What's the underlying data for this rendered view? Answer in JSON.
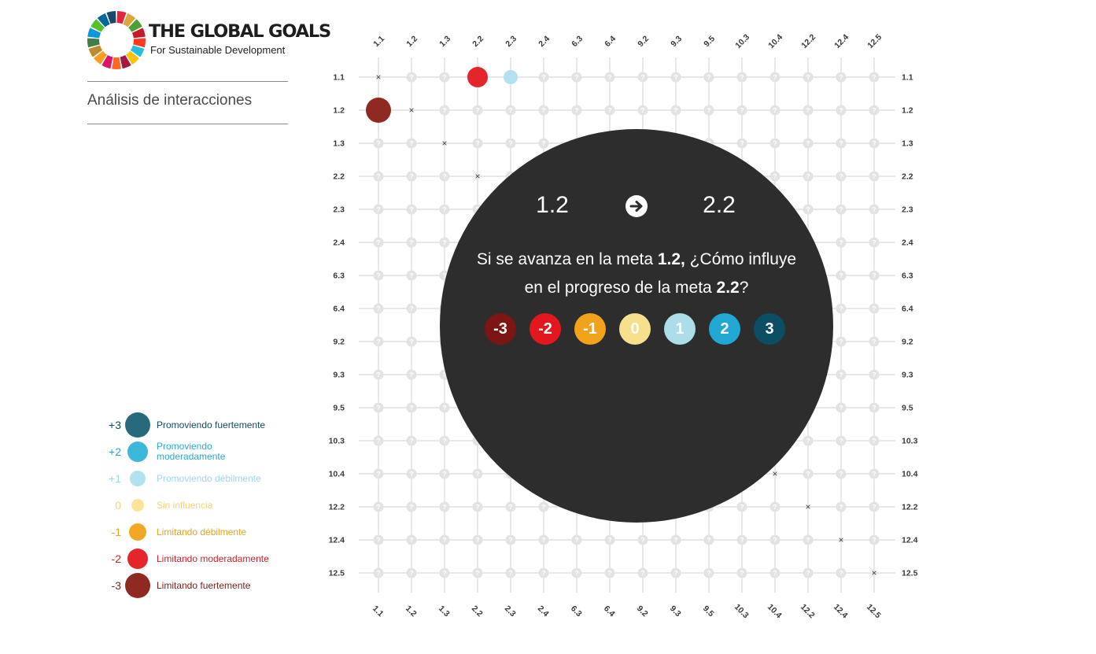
{
  "logo": {
    "title": "THE GLOBAL GOALS",
    "subtitle": "For Sustainable Development",
    "wheel_colors": [
      "#e5243b",
      "#dda63a",
      "#4c9f38",
      "#c5192d",
      "#ff3a21",
      "#26bde2",
      "#fcc30b",
      "#a21942",
      "#fd6925",
      "#dd1367",
      "#fd9d24",
      "#bf8b2e",
      "#3f7e44",
      "#0a97d9",
      "#56c02b",
      "#00689d",
      "#19486a"
    ]
  },
  "section_title": "Análisis de interacciones",
  "legend": [
    {
      "value": "+3",
      "label": "Promoviendo fuertemente",
      "color": "#266a7c",
      "text_color": "#0f4c5c"
    },
    {
      "value": "+2",
      "label": "Promoviendo moderadamente",
      "color": "#3cb8d8",
      "text_color": "#2aa9cf"
    },
    {
      "value": "+1",
      "label": "Promoviendo débilmente",
      "color": "#b3e1ef",
      "text_color": "#9fd6ea"
    },
    {
      "value": "0",
      "label": "Sin influencia",
      "color": "#fbe39a",
      "text_color": "#f2d27a"
    },
    {
      "value": "-1",
      "label": "Limitando débilmente",
      "color": "#f1a925",
      "text_color": "#e8a21f"
    },
    {
      "value": "-2",
      "label": "Limitando moderadamente",
      "color": "#e4262b",
      "text_color": "#d61f26"
    },
    {
      "value": "-3",
      "label": "Limitando fuertemente",
      "color": "#8e2a22",
      "text_color": "#7a1f18"
    }
  ],
  "matrix": {
    "targets": [
      "1.1",
      "1.2",
      "1.3",
      "2.2",
      "2.3",
      "2.4",
      "6.3",
      "6.4",
      "9.2",
      "9.3",
      "9.5",
      "10.3",
      "10.4",
      "12.2",
      "12.4",
      "12.5"
    ],
    "unknown_glyph": "?",
    "diagonal_glyph": "×",
    "ratings": [
      {
        "row": "1.1",
        "col": "2.2",
        "score": -2
      },
      {
        "row": "1.1",
        "col": "2.3",
        "score": 1
      },
      {
        "row": "1.2",
        "col": "1.1",
        "score": -3
      }
    ]
  },
  "overlay": {
    "from": "1.2",
    "to": "2.2",
    "q_prefix": "Si se avanza en la meta ",
    "q_from": "1.2,",
    "q_mid": " ¿Cómo influye en el progreso de la meta ",
    "q_to": "2.2",
    "q_suffix": "?",
    "scores": [
      {
        "label": "-3",
        "color": "#7c1514"
      },
      {
        "label": "-2",
        "color": "#e5171e"
      },
      {
        "label": "-1",
        "color": "#f2a21b"
      },
      {
        "label": "0",
        "color": "#f6df8d"
      },
      {
        "label": "1",
        "color": "#acdde9"
      },
      {
        "label": "2",
        "color": "#22a6d2"
      },
      {
        "label": "3",
        "color": "#0b4e64"
      }
    ]
  }
}
